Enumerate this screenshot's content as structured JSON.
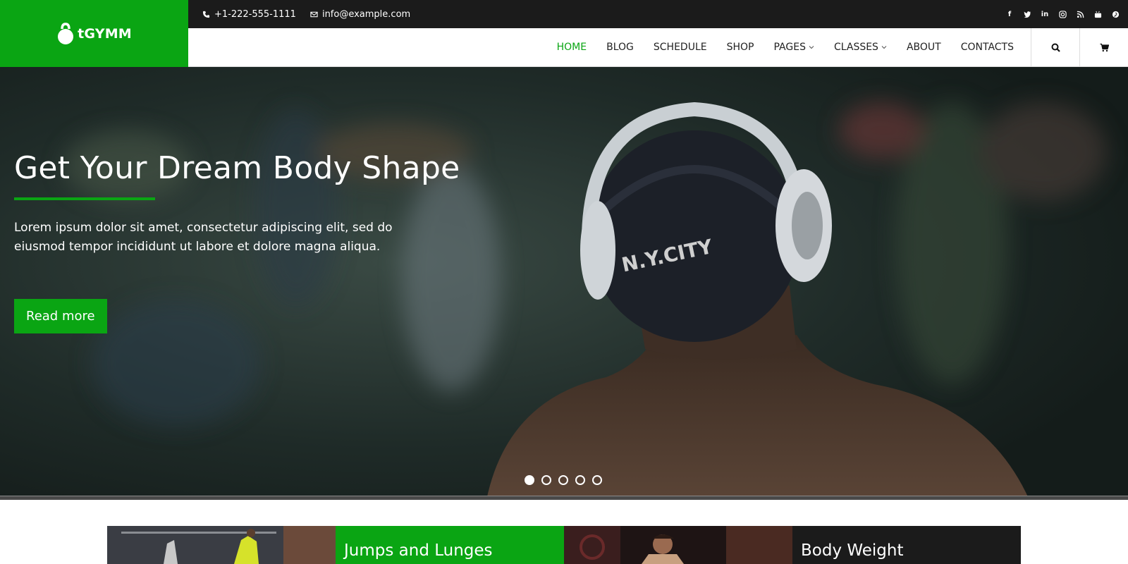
{
  "brand": {
    "name": "tGYMM",
    "color": "#0aa513"
  },
  "topbar": {
    "phone": "+1-222-555-1111",
    "email": "info@example.com",
    "socials": [
      "facebook-icon",
      "twitter-icon",
      "linkedin-icon",
      "instagram-icon",
      "rss-icon",
      "youtube-icon",
      "pinterest-icon"
    ]
  },
  "nav": {
    "items": [
      {
        "label": "HOME",
        "active": true
      },
      {
        "label": "BLOG"
      },
      {
        "label": "SCHEDULE"
      },
      {
        "label": "SHOP"
      },
      {
        "label": "PAGES",
        "dropdown": true
      },
      {
        "label": "CLASSES",
        "dropdown": true
      },
      {
        "label": "ABOUT"
      },
      {
        "label": "CONTACTS"
      }
    ],
    "search_icon": "search-icon",
    "cart_icon": "cart-icon"
  },
  "hero": {
    "title": "Get Your Dream Body Shape",
    "text": "Lorem ipsum dolor sit amet, consectetur adipiscing elit, sed do eiusmod tempor incididunt ut labore et dolore magna aliqua.",
    "button": "Read more",
    "slides": 5,
    "active_slide": 1
  },
  "classes": [
    {
      "title": "Jumps and Lunges"
    },
    {
      "title": "Body Weight"
    }
  ]
}
